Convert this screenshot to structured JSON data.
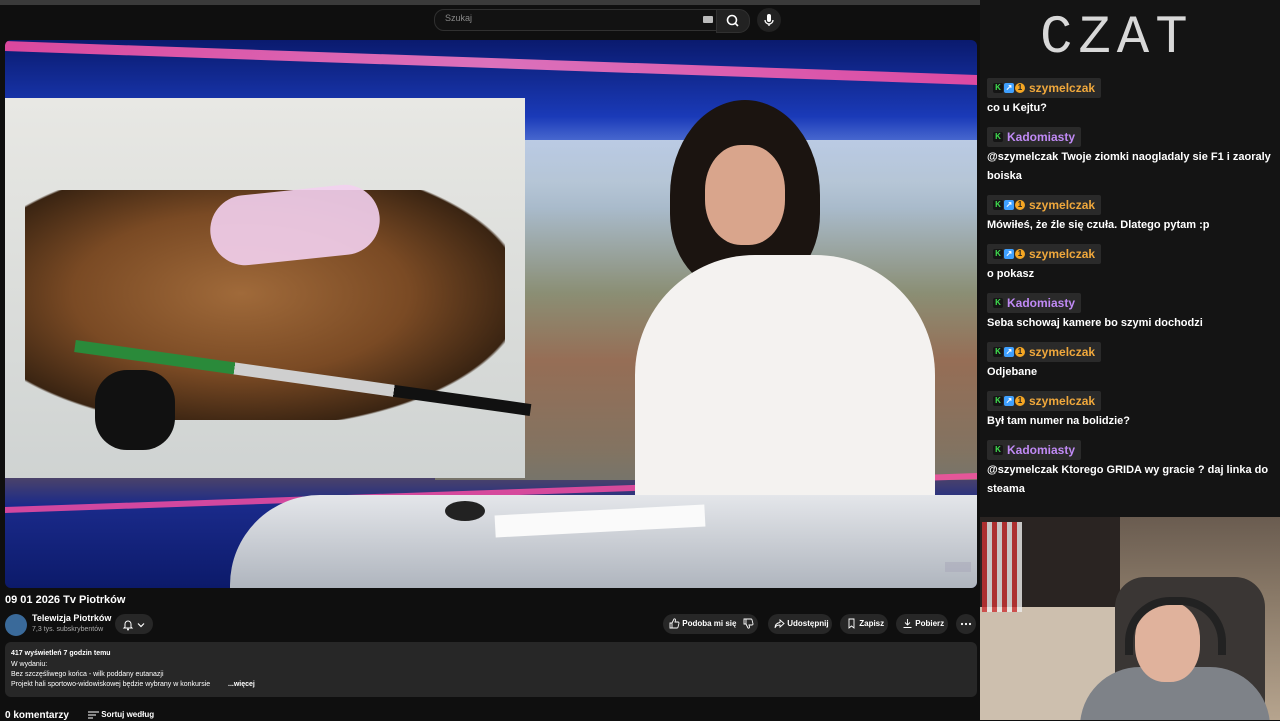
{
  "search": {
    "placeholder": "Szukaj"
  },
  "video": {
    "title": "09 01 2026 Tv Piotrków",
    "channel": {
      "name": "Telewizja Piotrków",
      "subscribers": "7,3 tys. subskrybentów"
    },
    "actions": {
      "like": "Podoba mi się",
      "share": "Udostępnij",
      "save": "Zapisz",
      "download": "Pobierz"
    },
    "description": {
      "stats": "417 wyświetleń  7 godzin temu",
      "lines": [
        "W wydaniu:",
        "Bez szczęśliwego końca - wilk poddany eutanazji",
        "Projekt hali  sportowo-widowiskowej będzie wybrany w konkursie"
      ],
      "more": "...więcej"
    },
    "comments_count": "0 komentarzy",
    "sort_label": "Sortuj według"
  },
  "chat": {
    "title": "CZAT",
    "colors": {
      "szymelczak": "#f0a83c",
      "Kadomiasty": "#c08af5"
    },
    "messages": [
      {
        "user": "szymelczak",
        "text": "co u Kejtu?"
      },
      {
        "user": "Kadomiasty",
        "text": "@szymelczak Twoje ziomki naogladaly sie F1 i zaoraly boiska"
      },
      {
        "user": "szymelczak",
        "text": "Mówiłeś, że źle się czuła. Dlatego pytam :p"
      },
      {
        "user": "szymelczak",
        "text": "o pokasz"
      },
      {
        "user": "Kadomiasty",
        "text": "Seba schowaj kamere bo szymi dochodzi"
      },
      {
        "user": "szymelczak",
        "text": "Odjebane"
      },
      {
        "user": "szymelczak",
        "text": "Był tam numer na bolidzie?"
      },
      {
        "user": "Kadomiasty",
        "text": "@szymelczak Ktorego GRIDA wy gracie ? daj linka do steama"
      }
    ]
  }
}
